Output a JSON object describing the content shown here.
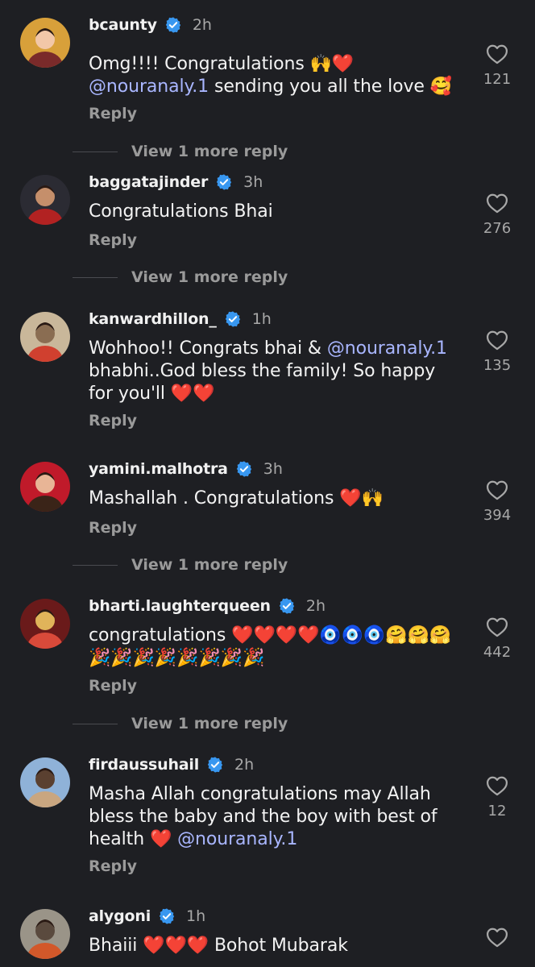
{
  "comments": [
    {
      "username": "bcaunty",
      "time": "2h",
      "text_parts": [
        {
          "t": "Omg!!!! Congratulations 🙌",
          "k": "text"
        },
        {
          "t": "❤️",
          "k": "heart"
        },
        {
          "t": "@nouranaly.1",
          "k": "mention"
        },
        {
          "t": " sending you all the love 🥰",
          "k": "text"
        }
      ],
      "reply": "Reply",
      "likes": "121",
      "view_more": "View 1 more reply",
      "avatar_colors": [
        "#d8a03a",
        "#7a2a2a",
        "#f2c7a8"
      ]
    },
    {
      "username": "baggatajinder",
      "time": "3h",
      "text_parts": [
        {
          "t": "Congratulations Bhai",
          "k": "text"
        }
      ],
      "reply": "Reply",
      "likes": "276",
      "view_more": "View 1 more reply",
      "avatar_colors": [
        "#2b2b33",
        "#b22222",
        "#c58f6b"
      ]
    },
    {
      "username": "kanwardhillon_",
      "time": "1h",
      "text_parts": [
        {
          "t": "Wohhoo!! Congrats bhai & ",
          "k": "text"
        },
        {
          "t": "@nouranaly.1",
          "k": "mention"
        },
        {
          "t": " bhabhi..God bless the family! So happy for you'll ",
          "k": "text"
        },
        {
          "t": "❤️❤️",
          "k": "heart"
        }
      ],
      "reply": "Reply",
      "likes": "135",
      "view_more": "",
      "avatar_colors": [
        "#c9b79a",
        "#d0402f",
        "#8a6d52"
      ]
    },
    {
      "username": "yamini.malhotra",
      "time": "3h",
      "text_parts": [
        {
          "t": "Mashallah . Congratulations ",
          "k": "text"
        },
        {
          "t": "❤️",
          "k": "heart"
        },
        {
          "t": "🙌",
          "k": "text"
        }
      ],
      "reply": "Reply",
      "likes": "394",
      "view_more": "View 1 more reply",
      "avatar_colors": [
        "#c01a2a",
        "#3a2418",
        "#e8b596"
      ]
    },
    {
      "username": "bharti.laughterqueen",
      "time": "2h",
      "text_parts": [
        {
          "t": "congratulations ",
          "k": "text"
        },
        {
          "t": "❤️❤️❤️❤️",
          "k": "heart"
        },
        {
          "t": "🧿🧿🧿🤗🤗🤗🎉🎉🎉🎉🎉🎉🎉🎉",
          "k": "text"
        }
      ],
      "reply": "Reply",
      "likes": "442",
      "view_more": "View 1 more reply",
      "avatar_colors": [
        "#6a1a1a",
        "#d94a3a",
        "#e0b45a"
      ]
    },
    {
      "username": "firdaussuhail",
      "time": "2h",
      "text_parts": [
        {
          "t": "Masha Allah congratulations may Allah bless the baby and the boy with best of health ",
          "k": "text"
        },
        {
          "t": "❤️",
          "k": "heart"
        },
        {
          "t": " ",
          "k": "text"
        },
        {
          "t": "@nouranaly.1",
          "k": "mention"
        }
      ],
      "reply": "Reply",
      "likes": "12",
      "view_more": "",
      "avatar_colors": [
        "#8fb2d8",
        "#c9a680",
        "#5a4030"
      ]
    },
    {
      "username": "alygoni",
      "time": "1h",
      "text_parts": [
        {
          "t": "Bhaiii ",
          "k": "text"
        },
        {
          "t": "❤️❤️❤️",
          "k": "heart"
        },
        {
          "t": " Bohot Mubarak",
          "k": "text"
        }
      ],
      "reply": "",
      "likes": "",
      "view_more": "",
      "avatar_colors": [
        "#9a9488",
        "#d2582a",
        "#5a4a3e"
      ]
    }
  ],
  "icons": {
    "verified": "verified-badge-icon",
    "like": "heart-outline-icon"
  },
  "colors": {
    "background": "#1e1f23",
    "mention": "#a9b6ff",
    "verified": "#3897f0",
    "heart": "#ff2b3f"
  }
}
